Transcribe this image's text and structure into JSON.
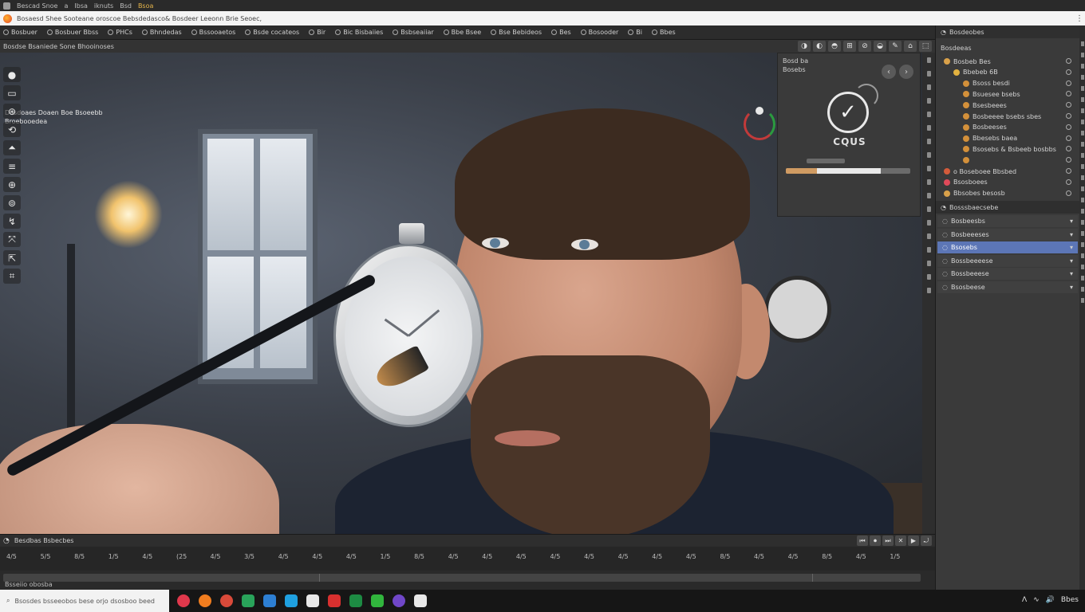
{
  "os_bar": {
    "title": "Bsoa",
    "items": [
      "Bescad  Snoe",
      "a",
      "Ibsa",
      "iknuts",
      "Bsd"
    ]
  },
  "browser": {
    "url": "Bosaesd  Shee Sooteane oroscoe Bebsdedasco&  Bosdeer Leeonn Brie  Seoec,",
    "menu_icon": "⋮"
  },
  "menu": {
    "items": [
      "Bosbuer",
      "Bosbuer Bbss",
      "PHCs",
      "Bhndedas",
      "Bssooaetos",
      "Bsde cocateos",
      "Bir",
      "Bic Bisbaiies",
      "Bsbseaiiar",
      "Bbe Bsee",
      "Bse Bebideos",
      "Bes",
      "Bosooder",
      "Bi",
      "Bbes"
    ]
  },
  "viewport": {
    "header_label": "Bosdse Bsaniede Sone Bhooinoses",
    "overlay_line1": "Dosdoaes Doaen Boe Bsoeebb",
    "overlay_line2": "Broebooedea",
    "header_tools": [
      "◑",
      "◐",
      "◓",
      "⊞",
      "⊘",
      "◒",
      "✎",
      "⌂",
      "⬚"
    ],
    "left_tools": [
      "●",
      "▭",
      "⊛",
      "⟲",
      "⏶",
      "≡",
      "⊕",
      "⊚",
      "↯",
      "⤧",
      "⇱",
      "⌗"
    ]
  },
  "float_panel": {
    "line1": "Bosd ba",
    "line2": "Bosebs",
    "check_glyph": "✓",
    "name": "CQUS",
    "progress_fill": 0.25,
    "progress_white": 0.76
  },
  "timeline": {
    "header_label": "Besdbas Bsbecbes",
    "track_label": "Bsseiio obosba",
    "controls": [
      "⏮",
      "⏺",
      "⏭",
      "✕",
      "▶",
      "⤾"
    ],
    "ticks": [
      "4/5",
      "5/5",
      "8/5",
      "1/5",
      "4/5",
      "(25",
      "4/5",
      "3/5",
      "4/5",
      "4/5",
      "4/5",
      "1/5",
      "8/5",
      "4/5",
      "4/5",
      "4/5",
      "4/5",
      "4/5",
      "4/5",
      "4/5",
      "4/5",
      "8/5",
      "4/5",
      "4/5",
      "8/5",
      "4/5",
      "1/5"
    ]
  },
  "outliner": {
    "header": "Bosdeobes",
    "sub_header": "Bosdeeas",
    "tree": [
      {
        "label": "Bosbeb Bes",
        "color": "#d9a14a",
        "indent": 0
      },
      {
        "label": "Bbebeb 6B",
        "color": "#e3b240",
        "indent": 1
      },
      {
        "label": "Bsoss besdi",
        "color": "#d3903a",
        "indent": 2
      },
      {
        "label": "Bsuesee bsebs",
        "color": "#d3903a",
        "indent": 2
      },
      {
        "label": "Bsesbeees",
        "color": "#d3903a",
        "indent": 2
      },
      {
        "label": "Bosbeeee bsebs sbes",
        "color": "#d3903a",
        "indent": 2
      },
      {
        "label": "Bosbeeses",
        "color": "#d3903a",
        "indent": 2
      },
      {
        "label": "Bbesebs baea",
        "color": "#d3903a",
        "indent": 2
      },
      {
        "label": "Bsosebs & Bsbeeb bosbbs",
        "color": "#d3903a",
        "indent": 2
      },
      {
        "label": "",
        "color": "#d3903a",
        "indent": 2
      },
      {
        "label": "o Boseboee Bbsbed",
        "color": "#d35b3b",
        "indent": 0
      },
      {
        "label": "Bsosboees",
        "color": "#e04a5a",
        "indent": 0
      },
      {
        "label": "Bbsobes besosb",
        "color": "#d9a14a",
        "indent": 0
      }
    ],
    "props_header": "Bosssbaecsebe",
    "props": [
      {
        "label": "Bosbeesbs",
        "selected": false
      },
      {
        "label": "Bosbeeeses",
        "selected": false
      },
      {
        "label": "Bsosebs",
        "selected": true
      },
      {
        "label": "Bossbeeeese",
        "selected": false
      },
      {
        "label": "Bossbeeese",
        "selected": false
      },
      {
        "label": "Bsosbeese",
        "selected": false
      }
    ]
  },
  "taskbar": {
    "search_placeholder": "Bsosdes bsseeobos bese orjo dsosboo beed",
    "apps": [
      {
        "name": "app-red",
        "color": "#e0384c"
      },
      {
        "name": "app-orange",
        "color": "#f07d1f"
      },
      {
        "name": "app-chrome",
        "color": "#d94a3a"
      },
      {
        "name": "app-green",
        "color": "#29a35a"
      },
      {
        "name": "app-blue",
        "color": "#2d7fd3"
      },
      {
        "name": "app-edge",
        "color": "#1fa0e0"
      },
      {
        "name": "app-white",
        "color": "#e8e8e8"
      },
      {
        "name": "app-red2",
        "color": "#d8302f"
      },
      {
        "name": "app-green2",
        "color": "#1d8b43"
      },
      {
        "name": "app-green3",
        "color": "#31b53d"
      },
      {
        "name": "app-purple",
        "color": "#7047c8"
      },
      {
        "name": "app-chat",
        "color": "#e8e8e8"
      }
    ],
    "tray": [
      "ᐱ",
      "∿",
      "🔊",
      "Bbes"
    ]
  },
  "colors": {
    "accent_selection": "#5c76b6",
    "progress_orange": "#d09b62"
  }
}
